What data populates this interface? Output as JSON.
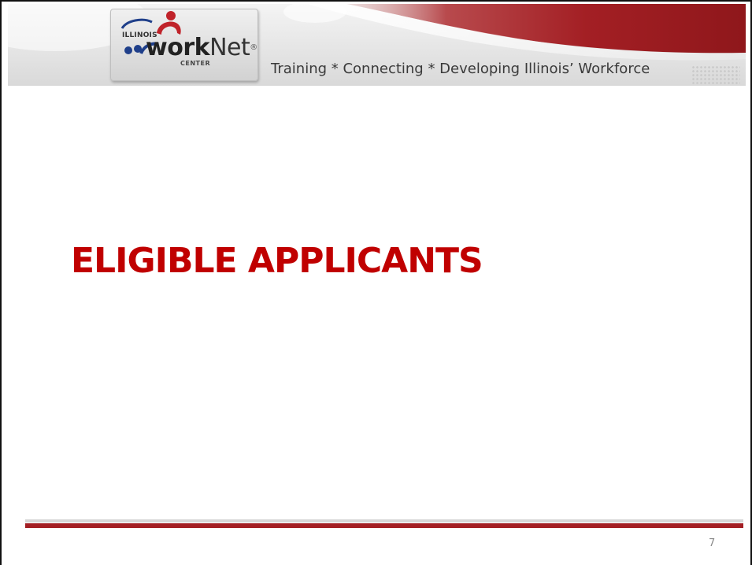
{
  "header": {
    "logo": {
      "state": "ILLINOIS",
      "work": "work",
      "net": "Net",
      "registered": "®",
      "center": "CENTER"
    },
    "tagline": "Training * Connecting * Developing Illinois’ Workforce"
  },
  "slide": {
    "title": "ELIGIBLE APPLICANTS",
    "page_number": "7"
  },
  "colors": {
    "title_red": "#c00000",
    "banner_red": "#a31f24",
    "footer_red": "#a31f24",
    "footer_grey": "#d7d7d7"
  }
}
